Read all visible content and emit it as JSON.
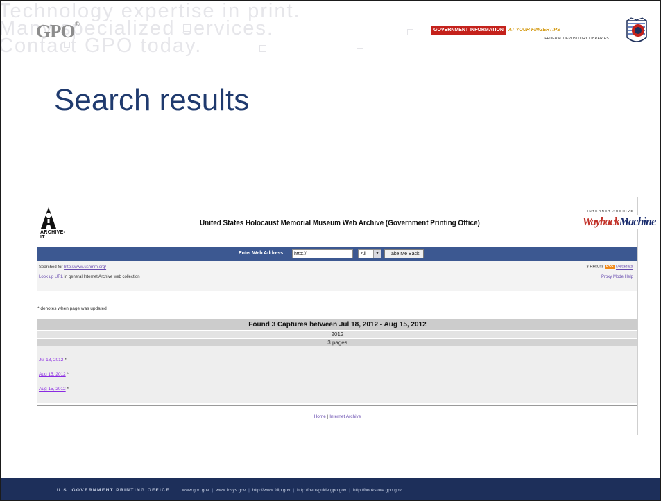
{
  "banner": {
    "tagline": "Technology expertise in print.\nMany specialized services.\nContact GPO today.",
    "gpo_logo": "GPO",
    "gov_info": {
      "red": "GOVERNMENT INFORMATION",
      "gold": "AT YOUR FINGERTIPS",
      "sub": "FEDERAL DEPOSITORY LIBRARIES"
    },
    "seal_icon": "fdlp-eagle-seal"
  },
  "slide_title": "Search results",
  "screenshot": {
    "archive_it_label": "ARCHIVE-IT",
    "page_heading": "United States Holocaust Memorial Museum Web Archive (Government Printing Office)",
    "wayback": {
      "ia_text": "INTERNET ARCHIVE",
      "logo_a": "Wayback",
      "logo_b": "Machine"
    },
    "search_bar": {
      "label": "Enter Web Address:",
      "url_value": "http://",
      "select_value": "All",
      "button": "Take Me Back"
    },
    "searched_for_prefix": "Searched for",
    "searched_for_url": "http://www.ushmm.org/",
    "lookup_link": "Look up URL",
    "lookup_suffix": "in general Internet Archive web collection",
    "results_count": "3 Results",
    "rss_label": "RSS",
    "metadata_link": "Metadata",
    "proxy_help_link": "Proxy Mode Help",
    "note": "* denotes when page was updated",
    "found": "Found 3 Captures between Jul 18, 2012 - Aug 15, 2012",
    "year": "2012",
    "pages": "3 pages",
    "captures": [
      {
        "date": "Jul 18, 2012",
        "star": "*"
      },
      {
        "date": "Aug 15, 2012",
        "star": "*"
      },
      {
        "date": "Aug 15, 2012",
        "star": "*"
      }
    ],
    "footer": {
      "home": "Home",
      "sep": "|",
      "ia": "Internet Archive"
    }
  },
  "bottom_bar": {
    "org": "U.S. GOVERNMENT PRINTING OFFICE",
    "links": [
      "www.gpo.gov",
      "www.fdsys.gov",
      "http://www.fdlp.gov",
      "http://bensguide.gpo.gov",
      "http://bookstore.gpo.gov"
    ],
    "sep": "|"
  },
  "colors": {
    "title_blue": "#1f3a6e",
    "wayback_bar": "#3c5891",
    "bottom_bar": "#1d2f5a",
    "gov_red": "#c4211b"
  }
}
